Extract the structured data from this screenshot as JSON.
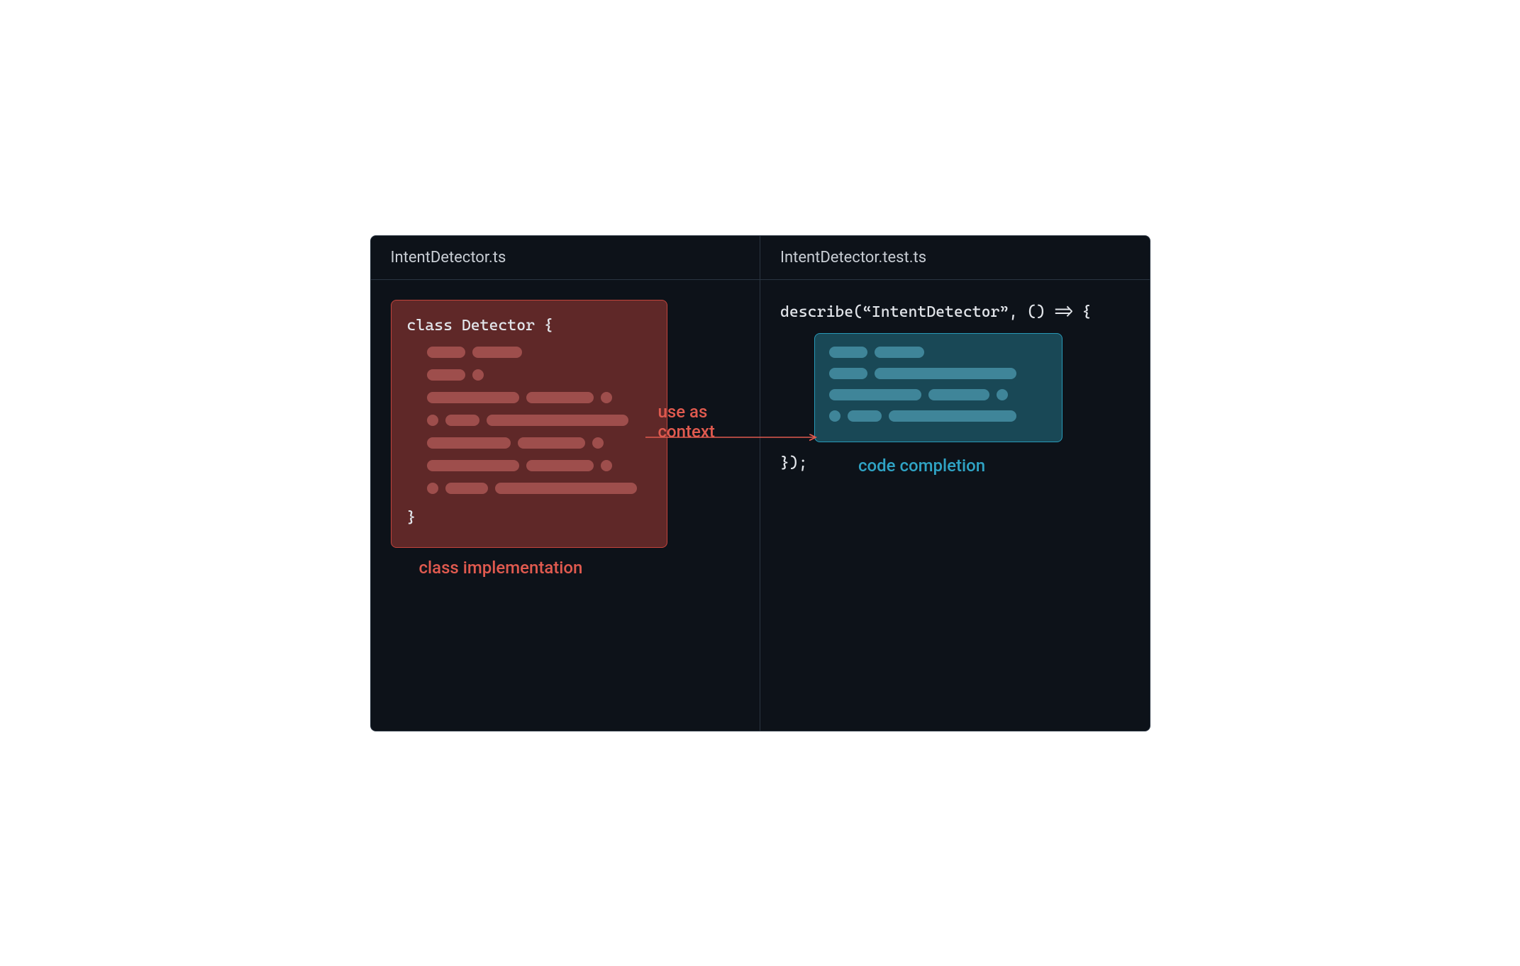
{
  "left": {
    "filename": "IntentDetector.ts",
    "code_open": "class Detector {",
    "code_close": "}",
    "label": "class implementation"
  },
  "right": {
    "filename": "IntentDetector.test.ts",
    "code_open": "describe(“IntentDetector”, () => {",
    "code_close": "});",
    "label": "code completion"
  },
  "arrow_label": "use as context",
  "colors": {
    "red": "#e05a4f",
    "teal": "#2fa3c4",
    "bg": "#0d1219"
  }
}
